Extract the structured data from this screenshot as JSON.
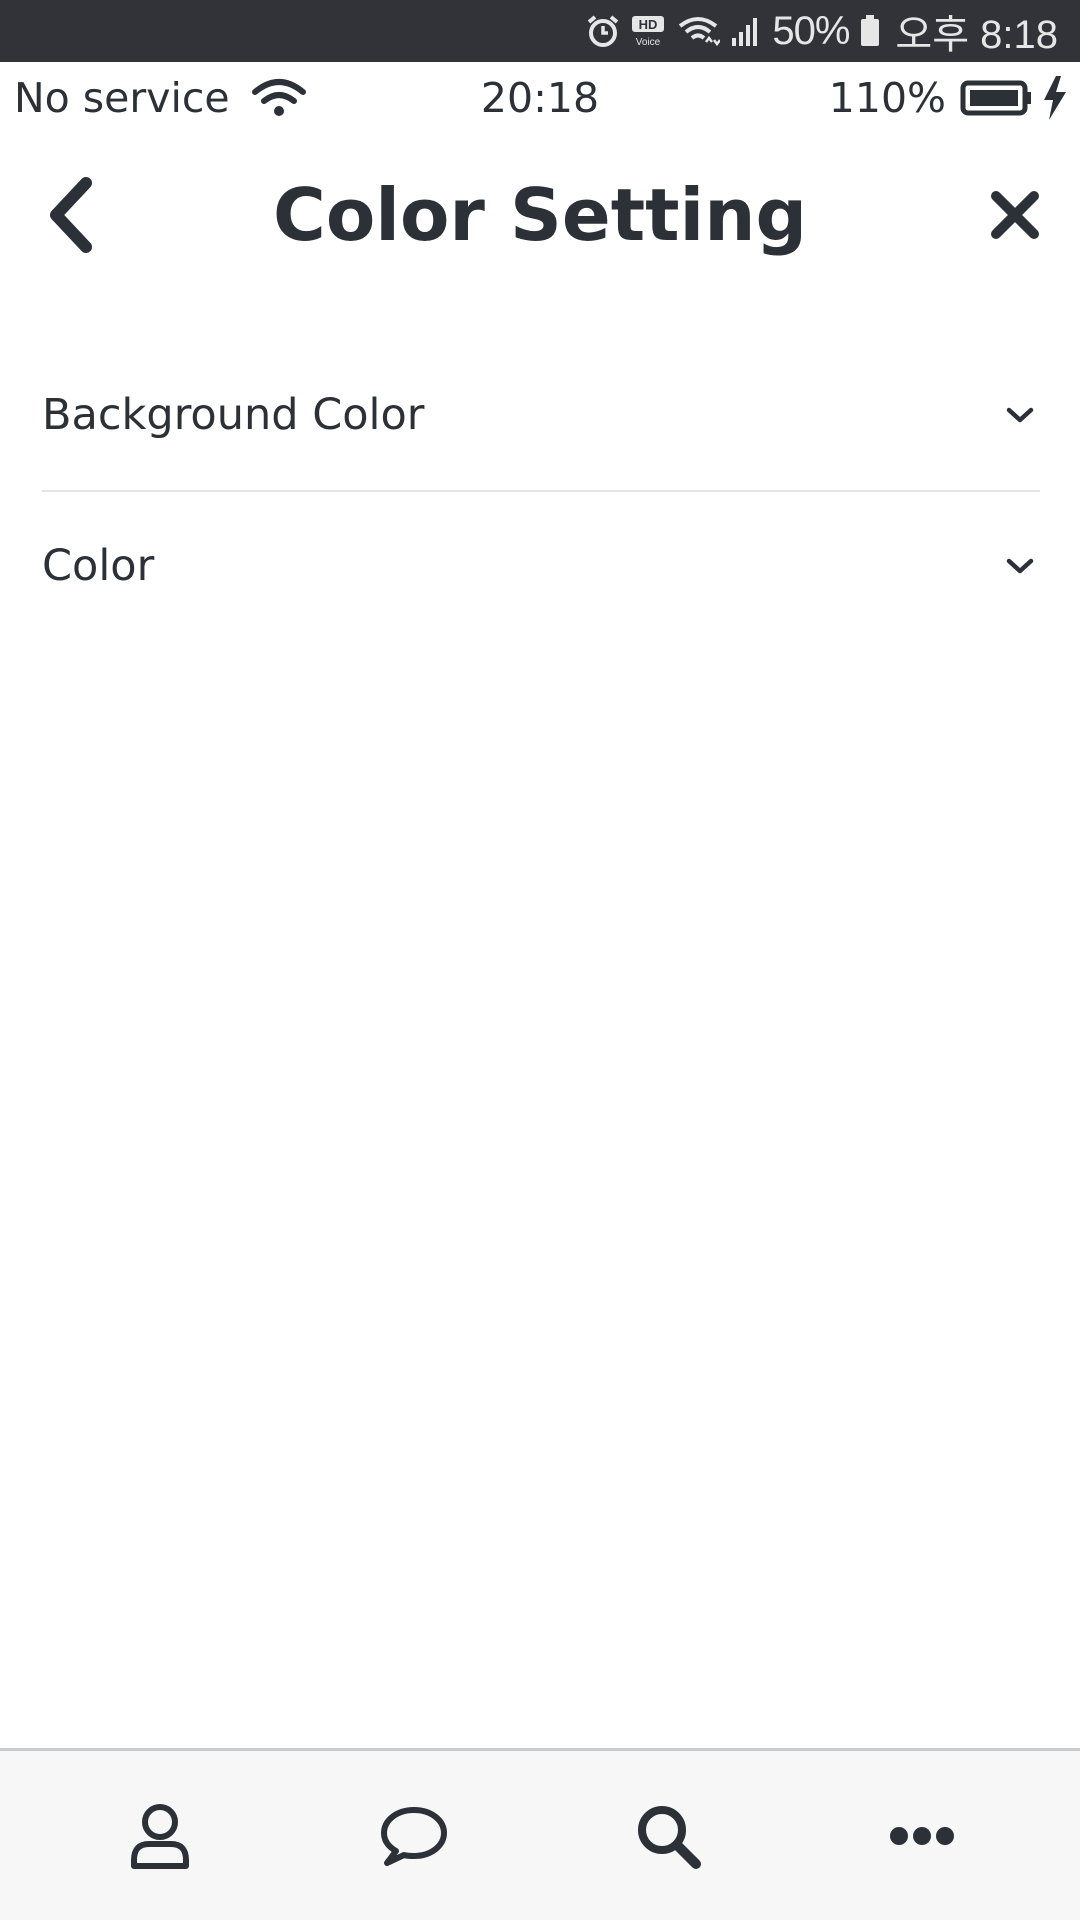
{
  "system_status": {
    "battery_percent": "50%",
    "time": "오후 8:18",
    "icons": [
      "alarm-icon",
      "hd-voice-icon",
      "wifi-icon",
      "signal-icon",
      "battery-icon"
    ],
    "hd_label": "HD",
    "voice_label": "Voice"
  },
  "app_status": {
    "carrier": "No service",
    "time": "20:18",
    "battery": "110%",
    "icons": [
      "wifi-icon",
      "battery-icon",
      "charging-bolt-icon"
    ]
  },
  "header": {
    "title": "Color Setting",
    "back_icon": "chevron-left-icon",
    "close_icon": "close-icon"
  },
  "settings": {
    "items": [
      {
        "label": "Background Color",
        "icon": "chevron-down-icon"
      },
      {
        "label": "Color",
        "icon": "chevron-down-icon"
      }
    ]
  },
  "tabbar": {
    "tabs": [
      {
        "icon": "person-icon"
      },
      {
        "icon": "chat-bubble-icon"
      },
      {
        "icon": "search-icon"
      },
      {
        "icon": "more-icon"
      }
    ]
  },
  "colors": {
    "system_bar_bg": "#323338",
    "text_dark": "#2c3138",
    "divider": "#e2e4e6",
    "tabbar_bg": "#f7f7f7"
  }
}
